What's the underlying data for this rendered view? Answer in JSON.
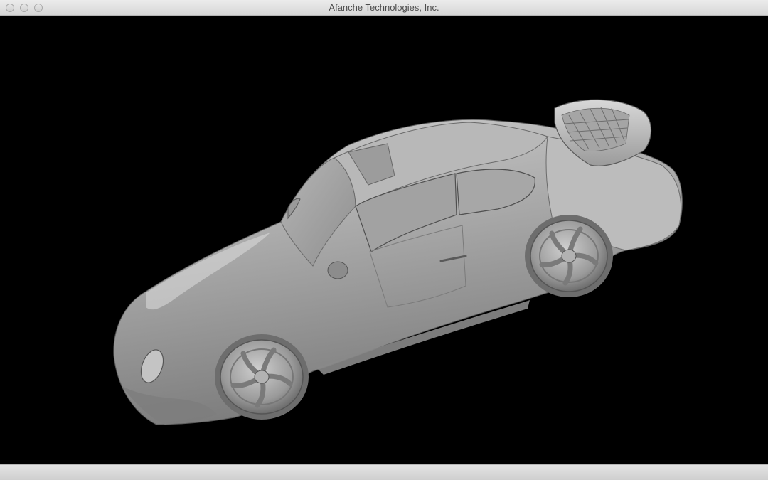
{
  "window": {
    "title": "Afanche Technologies, Inc."
  },
  "viewport": {
    "background": "#000000",
    "model_color": "#a8a8a8"
  },
  "icons": [
    "close-icon",
    "minimize-icon",
    "zoom-icon"
  ]
}
